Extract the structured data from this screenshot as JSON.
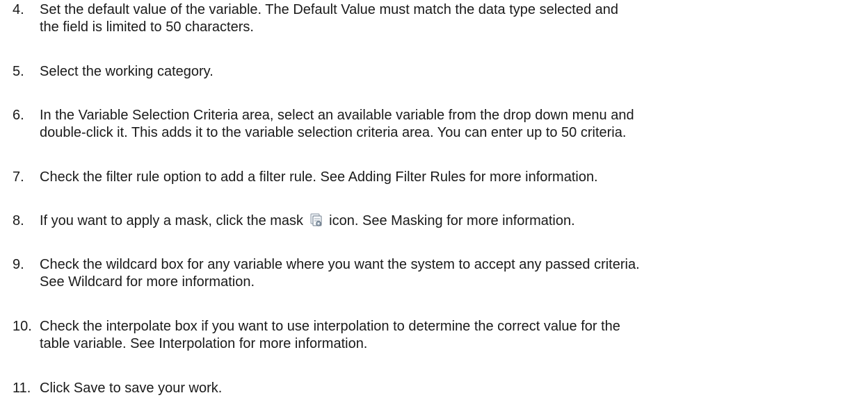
{
  "steps": [
    {
      "number": "4.",
      "lines": [
        "Set the default value of the variable. The Default Value must match the data type selected and",
        "the field is limited to 50 characters."
      ]
    },
    {
      "number": "5.",
      "lines": [
        "Select the working category."
      ]
    },
    {
      "number": "6.",
      "lines": [
        "In the Variable Selection Criteria area, select an available variable from the drop down menu and",
        "double-click it. This adds it to the variable selection criteria area. You can enter up to 50 criteria."
      ]
    },
    {
      "number": "7.",
      "lines": [
        "Check the filter rule option to add a filter rule. See Adding Filter Rules for more information."
      ]
    },
    {
      "number": "8.",
      "before_icon": "If you want to apply a mask, click the mask",
      "icon": "mask-icon",
      "after_icon": "icon. See Masking for more information."
    },
    {
      "number": "9.",
      "lines": [
        "Check the wildcard box for any variable where you want the system to accept any passed criteria.",
        "See Wildcard for more information."
      ]
    },
    {
      "number": "10.",
      "lines": [
        "Check the interpolate box if you want to use interpolation to determine the correct value for the",
        "table variable. See Interpolation for more information."
      ]
    },
    {
      "number": "11.",
      "lines": [
        "Click Save to save your work."
      ]
    }
  ]
}
